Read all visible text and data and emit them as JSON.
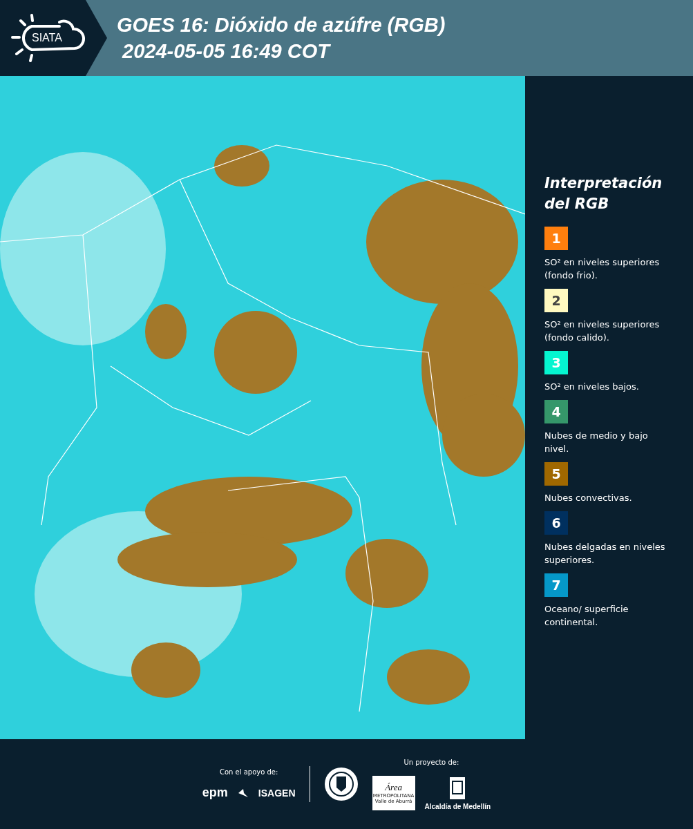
{
  "header": {
    "logo": "SIATA",
    "title": "GOES 16: Dióxido de azúfre (RGB)",
    "timestamp": "2024-05-05 16:49 COT"
  },
  "legend": {
    "title": "Interpretación del RGB",
    "items": [
      {
        "number": "1",
        "color": "#ff7f0e",
        "text": "SO² en niveles superiores (fondo frio)."
      },
      {
        "number": "2",
        "color": "#fff9c0",
        "text": "SO² en niveles superiores (fondo calido)."
      },
      {
        "number": "3",
        "color": "#05f5d0",
        "text": "SO² en niveles bajos."
      },
      {
        "number": "4",
        "color": "#35976a",
        "text": "Nubes de medio y bajo nivel."
      },
      {
        "number": "5",
        "color": "#a06800",
        "text": "Nubes convectivas."
      },
      {
        "number": "6",
        "color": "#00305f",
        "text": "Nubes delgadas en niveles superiores."
      },
      {
        "number": "7",
        "color": "#0598c9",
        "text": "Oceano/ superficie continental."
      }
    ]
  },
  "footer": {
    "support_label": "Con el apoyo de:",
    "project_label": "Un proyecto de:",
    "epm": "epm",
    "isagen": "ISAGEN",
    "area": "Área",
    "area_sub": "METROPOLITANA Valle de Aburrá",
    "alcaldia": "Alcaldía de Medellín"
  }
}
